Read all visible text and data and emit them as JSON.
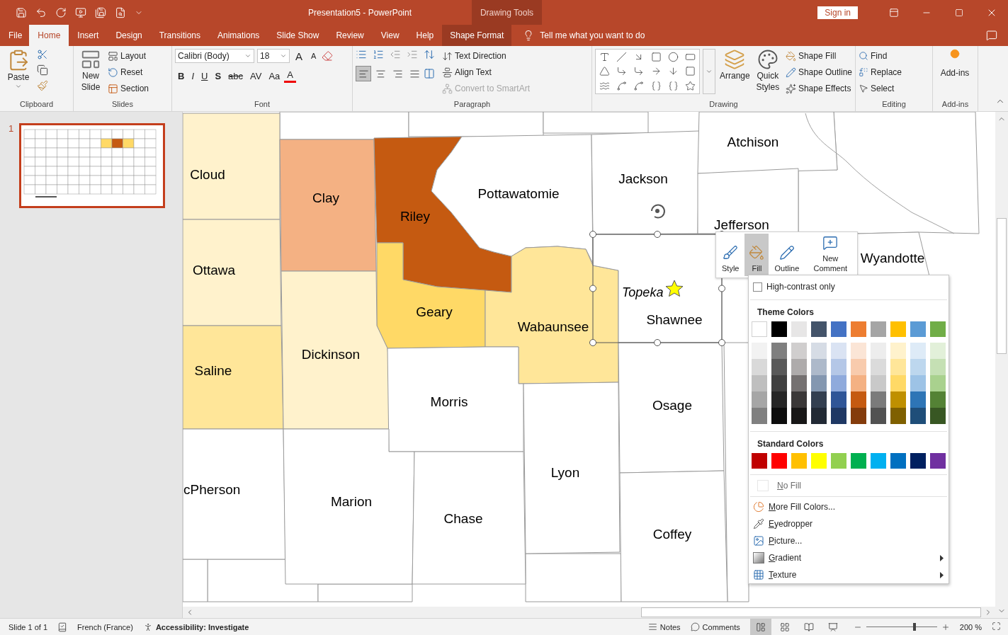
{
  "window": {
    "title": "Presentation5  -  PowerPoint",
    "context_label": "Drawing Tools",
    "sign_in": "Sign in"
  },
  "tabs": [
    {
      "label": "File",
      "selected": false,
      "kind": "file"
    },
    {
      "label": "Home",
      "selected": true,
      "kind": "normal"
    },
    {
      "label": "Insert",
      "selected": false,
      "kind": "normal"
    },
    {
      "label": "Design",
      "selected": false,
      "kind": "normal"
    },
    {
      "label": "Transitions",
      "selected": false,
      "kind": "normal"
    },
    {
      "label": "Animations",
      "selected": false,
      "kind": "normal"
    },
    {
      "label": "Slide Show",
      "selected": false,
      "kind": "normal"
    },
    {
      "label": "Review",
      "selected": false,
      "kind": "normal"
    },
    {
      "label": "View",
      "selected": false,
      "kind": "normal"
    },
    {
      "label": "Help",
      "selected": false,
      "kind": "normal"
    },
    {
      "label": "Shape Format",
      "selected": false,
      "kind": "contextual"
    }
  ],
  "tell_me": "Tell me what you want to do",
  "ribbon": {
    "clipboard": {
      "label": "Clipboard",
      "paste": "Paste"
    },
    "slides": {
      "label": "Slides",
      "new_slide": "New Slide",
      "layout": "Layout",
      "reset": "Reset",
      "section": "Section"
    },
    "font": {
      "label": "Font",
      "family": "Calibri (Body)",
      "size": "18",
      "grow": "A",
      "shrink": "A",
      "styles": [
        "B",
        "I",
        "U",
        "S",
        "abc",
        "AV",
        "Aa"
      ],
      "color_letter": "A"
    },
    "paragraph": {
      "label": "Paragraph",
      "text_direction": "Text Direction",
      "align_text": "Align Text",
      "smartart": {
        "label": "Convert to SmartArt",
        "disabled": true
      },
      "alignment": [
        {
          "selected": true
        },
        {
          "selected": false
        },
        {
          "selected": false
        },
        {
          "selected": false
        }
      ]
    },
    "drawing": {
      "label": "Drawing",
      "arrange": "Arrange",
      "quick_styles": "Quick Styles",
      "shape_fill": "Shape Fill",
      "shape_outline": "Shape Outline",
      "shape_effects": "Shape Effects"
    },
    "editing": {
      "label": "Editing",
      "find": "Find",
      "replace": "Replace",
      "select": "Select"
    },
    "addins": {
      "label": "Add-ins",
      "button": "Add-ins"
    }
  },
  "slides_pane": {
    "slides": [
      {
        "number": "1",
        "selected": true
      }
    ]
  },
  "map": {
    "counties": [
      {
        "name": "Cloud",
        "color": "#fff2cc",
        "selected": false
      },
      {
        "name": "Clay",
        "color": "#f4b183",
        "selected": false
      },
      {
        "name": "Riley",
        "color": "#c55a11",
        "selected": false
      },
      {
        "name": "Pottawatomie",
        "color": "#ffffff",
        "selected": false
      },
      {
        "name": "Jackson",
        "color": "#ffffff",
        "selected": false
      },
      {
        "name": "Atchison",
        "color": "#ffffff",
        "selected": false
      },
      {
        "name": "Jefferson",
        "color": "#ffffff",
        "selected": false
      },
      {
        "name": "Ottawa",
        "color": "#fff2cc",
        "selected": false
      },
      {
        "name": "Geary",
        "color": "#ffd966",
        "selected": false
      },
      {
        "name": "Wabaunsee",
        "color": "#ffe699",
        "selected": false
      },
      {
        "name": "Shawnee",
        "color": "#ffffff",
        "selected": true
      },
      {
        "name": "Wyandotte",
        "color": "#ffffff",
        "selected": false
      },
      {
        "name": "Saline",
        "color": "#ffe699",
        "selected": false
      },
      {
        "name": "Dickinson",
        "color": "#fff2cc",
        "selected": false
      },
      {
        "name": "Morris",
        "color": "#ffffff",
        "selected": false
      },
      {
        "name": "Osage",
        "color": "#ffffff",
        "selected": false
      },
      {
        "name": "cPherson",
        "color": "#ffffff",
        "selected": false
      },
      {
        "name": "Marion",
        "color": "#ffffff",
        "selected": false
      },
      {
        "name": "Lyon",
        "color": "#ffffff",
        "selected": false
      },
      {
        "name": "Chase",
        "color": "#ffffff",
        "selected": false
      },
      {
        "name": "Coffey",
        "color": "#ffffff",
        "selected": false
      }
    ],
    "city": {
      "label": "Topeka"
    }
  },
  "mini_toolbar": [
    {
      "label": "Style",
      "selected": false
    },
    {
      "label": "Fill",
      "selected": true
    },
    {
      "label": "Outline",
      "selected": false
    },
    {
      "label": "New Comment",
      "selected": false
    }
  ],
  "fill_menu": {
    "high_contrast": {
      "label": "High-contrast only",
      "checked": false
    },
    "theme_title": "Theme Colors",
    "theme_colors": [
      {
        "color": "#ffffff"
      },
      {
        "color": "#000000"
      },
      {
        "color": "#e7e6e6"
      },
      {
        "color": "#44546a"
      },
      {
        "color": "#4472c4"
      },
      {
        "color": "#ed7d31"
      },
      {
        "color": "#a5a5a5"
      },
      {
        "color": "#ffc000"
      },
      {
        "color": "#5b9bd5"
      },
      {
        "color": "#70ad47"
      }
    ],
    "theme_shades": [
      {
        "shades": [
          {
            "color": "#f2f2f2"
          },
          {
            "color": "#d9d9d9"
          },
          {
            "color": "#bfbfbf"
          },
          {
            "color": "#a6a6a6"
          },
          {
            "color": "#808080"
          }
        ]
      },
      {
        "shades": [
          {
            "color": "#7f7f7f"
          },
          {
            "color": "#595959"
          },
          {
            "color": "#404040"
          },
          {
            "color": "#262626"
          },
          {
            "color": "#0d0d0d"
          }
        ]
      },
      {
        "shades": [
          {
            "color": "#d0cece"
          },
          {
            "color": "#aeabab"
          },
          {
            "color": "#757171"
          },
          {
            "color": "#3b3838"
          },
          {
            "color": "#181717"
          }
        ]
      },
      {
        "shades": [
          {
            "color": "#d6dce5"
          },
          {
            "color": "#adb9ca"
          },
          {
            "color": "#8497b0"
          },
          {
            "color": "#333f50"
          },
          {
            "color": "#222a35"
          }
        ]
      },
      {
        "shades": [
          {
            "color": "#dae3f3"
          },
          {
            "color": "#b4c7e7"
          },
          {
            "color": "#8faadc"
          },
          {
            "color": "#2f5597"
          },
          {
            "color": "#1f3864"
          }
        ]
      },
      {
        "shades": [
          {
            "color": "#fbe5d6"
          },
          {
            "color": "#f8cbad"
          },
          {
            "color": "#f4b183"
          },
          {
            "color": "#c55a11"
          },
          {
            "color": "#843c0c"
          }
        ]
      },
      {
        "shades": [
          {
            "color": "#ededed"
          },
          {
            "color": "#dbdbdb"
          },
          {
            "color": "#c9c9c9"
          },
          {
            "color": "#7b7b7b"
          },
          {
            "color": "#525252"
          }
        ]
      },
      {
        "shades": [
          {
            "color": "#fff2cc"
          },
          {
            "color": "#ffe699"
          },
          {
            "color": "#ffd966"
          },
          {
            "color": "#bf9000"
          },
          {
            "color": "#7f6000"
          }
        ]
      },
      {
        "shades": [
          {
            "color": "#deebf7"
          },
          {
            "color": "#bdd7ee"
          },
          {
            "color": "#9dc3e6"
          },
          {
            "color": "#2e75b6"
          },
          {
            "color": "#1f4e79"
          }
        ]
      },
      {
        "shades": [
          {
            "color": "#e2f0d9"
          },
          {
            "color": "#c5e0b4"
          },
          {
            "color": "#a9d18e"
          },
          {
            "color": "#548235"
          },
          {
            "color": "#385723"
          }
        ]
      }
    ],
    "standard_title": "Standard Colors",
    "standard_colors": [
      {
        "color": "#c00000"
      },
      {
        "color": "#ff0000"
      },
      {
        "color": "#ffc000"
      },
      {
        "color": "#ffff00"
      },
      {
        "color": "#92d050"
      },
      {
        "color": "#00b050"
      },
      {
        "color": "#00b0f0"
      },
      {
        "color": "#0070c0"
      },
      {
        "color": "#002060"
      },
      {
        "color": "#7030a0"
      }
    ],
    "no_fill": {
      "label": "No Fill",
      "disabled": true
    },
    "items": [
      {
        "label": "More Fill Colors...",
        "kind": "colors",
        "submenu": false
      },
      {
        "label": "Eyedropper",
        "kind": "eyedropper",
        "submenu": false
      },
      {
        "label": "Picture...",
        "kind": "picture",
        "submenu": false
      },
      {
        "label": "Gradient",
        "kind": "gradient",
        "submenu": true
      },
      {
        "label": "Texture",
        "kind": "texture",
        "submenu": true
      }
    ]
  },
  "status_bar": {
    "slide": "Slide 1 of 1",
    "language": "French (France)",
    "accessibility": "Accessibility: Investigate",
    "notes": "Notes",
    "comments": "Comments",
    "views": [
      {
        "selected": true
      },
      {
        "selected": false
      },
      {
        "selected": false
      },
      {
        "selected": false
      }
    ],
    "zoom": {
      "level": 0.68
    },
    "zoom_label": "200 %"
  }
}
